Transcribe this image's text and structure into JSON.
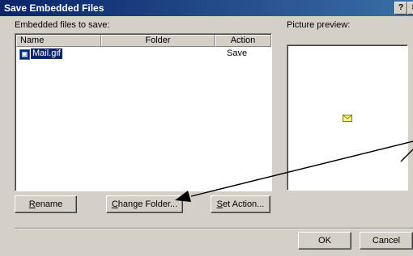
{
  "window": {
    "title": "Save Embedded Files",
    "help_label": "?",
    "close_label": "×"
  },
  "files_label": "Embedded files to save:",
  "preview_label": "Picture preview:",
  "columns": {
    "name": "Name",
    "folder": "Folder",
    "action": "Action"
  },
  "rows": [
    {
      "name": "Mail.gif",
      "folder": "",
      "action": "Save"
    }
  ],
  "buttons": {
    "rename_key": "R",
    "rename_rest": "ename",
    "change_key": "C",
    "change_rest": "hange Folder...",
    "setaction_key": "S",
    "setaction_rest": "et Action...",
    "ok": "OK",
    "cancel": "Cancel"
  },
  "colors": {
    "titlebar": "#0a246a",
    "selection": "#0a246a",
    "arrow": "#000000"
  }
}
